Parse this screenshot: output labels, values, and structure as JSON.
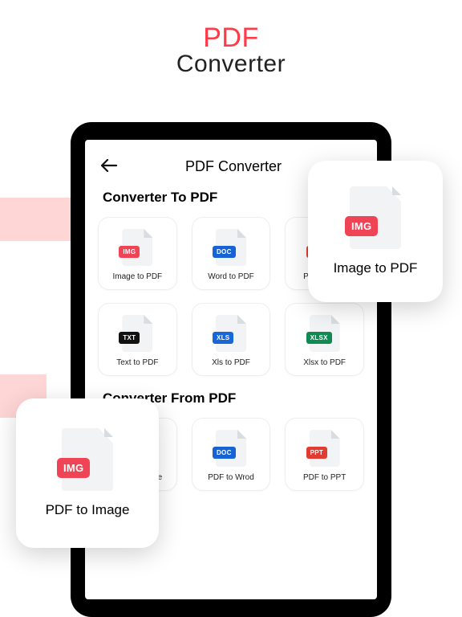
{
  "hero": {
    "line1": "PDF",
    "line2": "Converter"
  },
  "app": {
    "title": "PDF Converter",
    "section_to": "Converter To PDF",
    "section_from": "Converter From PDF"
  },
  "to_items": [
    {
      "label": "Image to PDF",
      "tag": "IMG",
      "color": "#ef4455"
    },
    {
      "label": "Word to PDF",
      "tag": "DOC",
      "color": "#1762d4"
    },
    {
      "label": "PPT to PDF",
      "tag": "PPT",
      "color": "#e23b32"
    },
    {
      "label": "Text to PDF",
      "tag": "TXT",
      "color": "#111111"
    },
    {
      "label": "Xls to PDF",
      "tag": "XLS",
      "color": "#1767d6"
    },
    {
      "label": "Xlsx to PDF",
      "tag": "XLSX",
      "color": "#0f8a52"
    }
  ],
  "from_items": [
    {
      "label": "PDF to Image",
      "tag": "IMG",
      "color": "#ef4455"
    },
    {
      "label": "PDF to Wrod",
      "tag": "DOC",
      "color": "#1762d4"
    },
    {
      "label": "PDF to PPT",
      "tag": "PPT",
      "color": "#e23b32"
    }
  ],
  "pop1": {
    "label": "Image to PDF",
    "tag": "IMG",
    "color": "#ef4455"
  },
  "pop2": {
    "label": "PDF to Image",
    "tag": "IMG",
    "color": "#ef4455"
  }
}
